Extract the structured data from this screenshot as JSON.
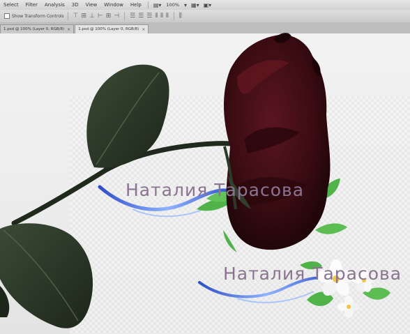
{
  "menubar": {
    "items": [
      "Select",
      "Filter",
      "Analysis",
      "3D",
      "View",
      "Window",
      "Help"
    ],
    "zoom": "100%"
  },
  "options_bar": {
    "show_transform_controls": "Show Transform Controls"
  },
  "tabs": [
    {
      "label": "1.psd @ 100% (Layer 0, RGB/8)"
    },
    {
      "label": "1.psd @ 100% (Layer 0, RGB/8)"
    }
  ],
  "watermarks": [
    {
      "text": "Наталия Тарасова"
    },
    {
      "text": "Наталия Тарасова"
    }
  ],
  "colors": {
    "rose": "#4a0f16",
    "leaf": "#2c3a28",
    "watermark_text": "#8a7490",
    "swirl": "#3c5fd0"
  }
}
